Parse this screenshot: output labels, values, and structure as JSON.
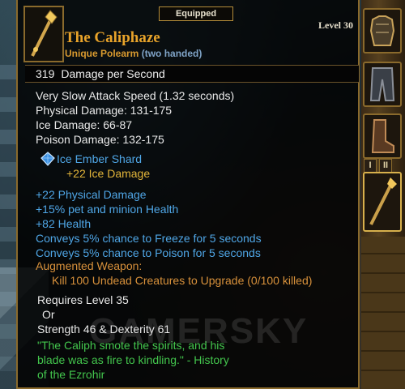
{
  "tooltip": {
    "equipped_tab": "Equipped",
    "level": "Level 30",
    "item_name": "The Caliphaze",
    "item_type": "Unique Polearm",
    "handedness": "(two handed)",
    "dps_value": "319",
    "dps_label": "Damage per Second",
    "attack_speed": "Very Slow Attack Speed (1.32 seconds)",
    "physical_damage": "Physical Damage: 131-175",
    "ice_damage": "Ice Damage: 66-87",
    "poison_damage": "Poison Damage: 132-175",
    "socket": {
      "gem_icon": "ice-gem-icon",
      "name": "Ice Ember Shard",
      "bonus": "+22 Ice Damage"
    },
    "enchantments": [
      "+22 Physical Damage",
      "+15% pet and minion Health",
      "+82 Health",
      "Conveys 5% chance to Freeze for 5 seconds",
      "Conveys 5% chance to Poison for 5 seconds"
    ],
    "augment_label": "Augmented Weapon:",
    "augment_detail": "Kill 100 Undead Creatures to Upgrade (0/100 killed)",
    "requirements": {
      "line1": "Requires Level 35",
      "or": "Or",
      "line2": "Strength 46 & Dexterity 61"
    },
    "lore": [
      "\"The Caliph smote the spirits, and his",
      "blade was as fire to kindling.\" - History",
      "of the Ezrohir"
    ]
  },
  "equipment_panel": {
    "slots": [
      "armor-slot-icon",
      "pants-slot-icon",
      "boots-slot-icon",
      "polearm-slot-icon"
    ],
    "toggle_buttons": [
      "I",
      "II"
    ]
  },
  "watermark": "GAMERSKY",
  "colors": {
    "unique_orange": "#e8a32a",
    "magic_blue": "#4fa6e6",
    "augment_orange": "#d8913b",
    "lore_green": "#43c64d",
    "border_gold": "#8a6a2c"
  }
}
